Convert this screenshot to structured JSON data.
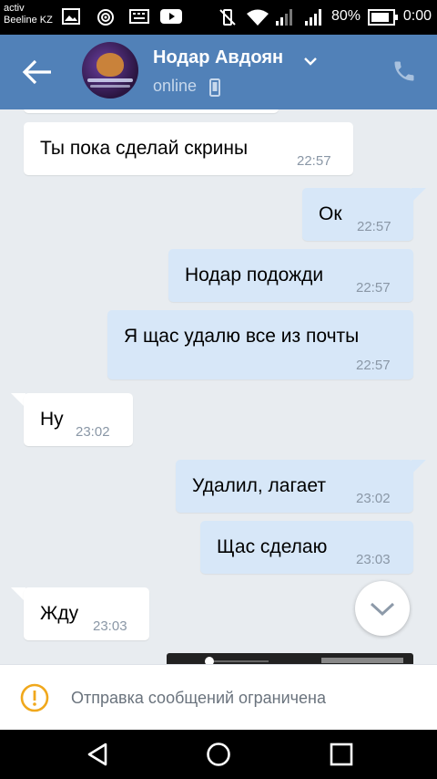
{
  "status_bar": {
    "carrier_top": "activ",
    "carrier_bottom": "Beeline KZ",
    "battery": "80%",
    "time": "0:00"
  },
  "header": {
    "contact_name": "Нодар Авдоян",
    "status": "online",
    "accent": "#5181b8"
  },
  "messages": [
    {
      "direction": "in",
      "text": "Ты пока сделай скрины",
      "time": "22:57"
    },
    {
      "direction": "out",
      "text": "Ок",
      "time": "22:57"
    },
    {
      "direction": "out",
      "text": "Нодар подожди",
      "time": "22:57"
    },
    {
      "direction": "out",
      "text": "Я щас удалю все из почты",
      "time": "22:57"
    },
    {
      "direction": "in",
      "text": "Ну",
      "time": "23:02"
    },
    {
      "direction": "out",
      "text": "Удалил, лагает",
      "time": "23:02"
    },
    {
      "direction": "out",
      "text": "Щас сделаю",
      "time": "23:03"
    },
    {
      "direction": "in",
      "text": "Жду",
      "time": "23:03"
    }
  ],
  "restriction": {
    "text": "Отправка сообщений ограничена",
    "icon": "warning-icon",
    "icon_color": "#f0a81c"
  },
  "nav": {
    "back": "back-icon",
    "home": "home-icon",
    "recents": "recents-icon"
  }
}
